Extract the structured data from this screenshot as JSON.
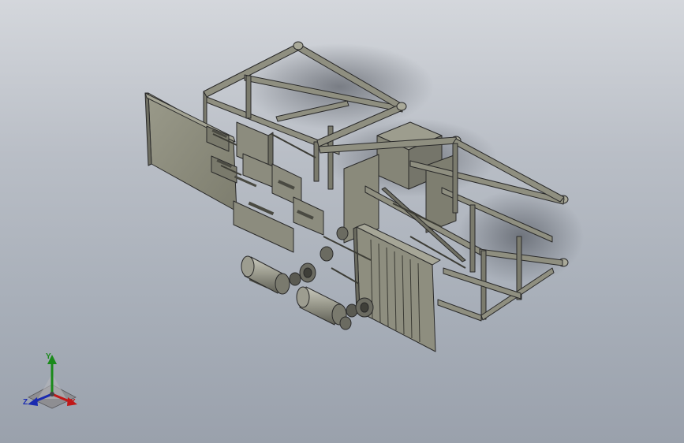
{
  "viewport": {
    "background_top": "#d4d7dc",
    "background_bottom": "#9aa1ac",
    "model_color": "#8f8f80",
    "edge_color": "#2a2a2a"
  },
  "triad": {
    "x_label": "X",
    "y_label": "Y",
    "z_label": "Z",
    "x_color": "#c01818",
    "y_color": "#1a8a1a",
    "z_color": "#1a2ab0"
  }
}
